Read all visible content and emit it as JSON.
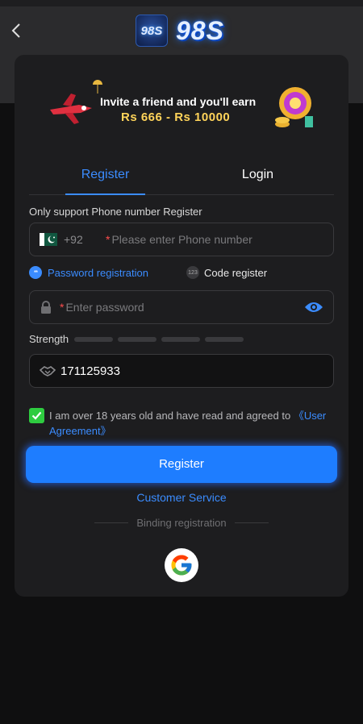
{
  "header": {
    "logo_small": "98S",
    "logo_text": "98S"
  },
  "banner": {
    "line1": "Invite a friend and you'll earn",
    "line2": "Rs 666 - Rs 10000"
  },
  "tabs": [
    {
      "label": "Register",
      "active": true
    },
    {
      "label": "Login",
      "active": false
    }
  ],
  "phone": {
    "label": "Only support Phone number Register",
    "country_code": "+92",
    "required_mark": "*",
    "placeholder": "Please enter Phone number"
  },
  "registration_options": {
    "password": "Password registration",
    "password_icon_text": "**",
    "code": "Code register",
    "code_icon_text": "123"
  },
  "password": {
    "required_mark": "*",
    "placeholder": "Enter password"
  },
  "strength": {
    "label": "Strength"
  },
  "invite_code": {
    "value": "171125933"
  },
  "agreement": {
    "text": "I am over 18 years old and have read and agreed to ",
    "link": "《User Agreement》",
    "checked": true
  },
  "register_button": "Register",
  "customer_service": "Customer Service",
  "binding_label": "Binding registration",
  "colors": {
    "accent": "#1e7dff",
    "link": "#3b8cff",
    "check": "#2ecc40",
    "required": "#ff4d4d"
  }
}
